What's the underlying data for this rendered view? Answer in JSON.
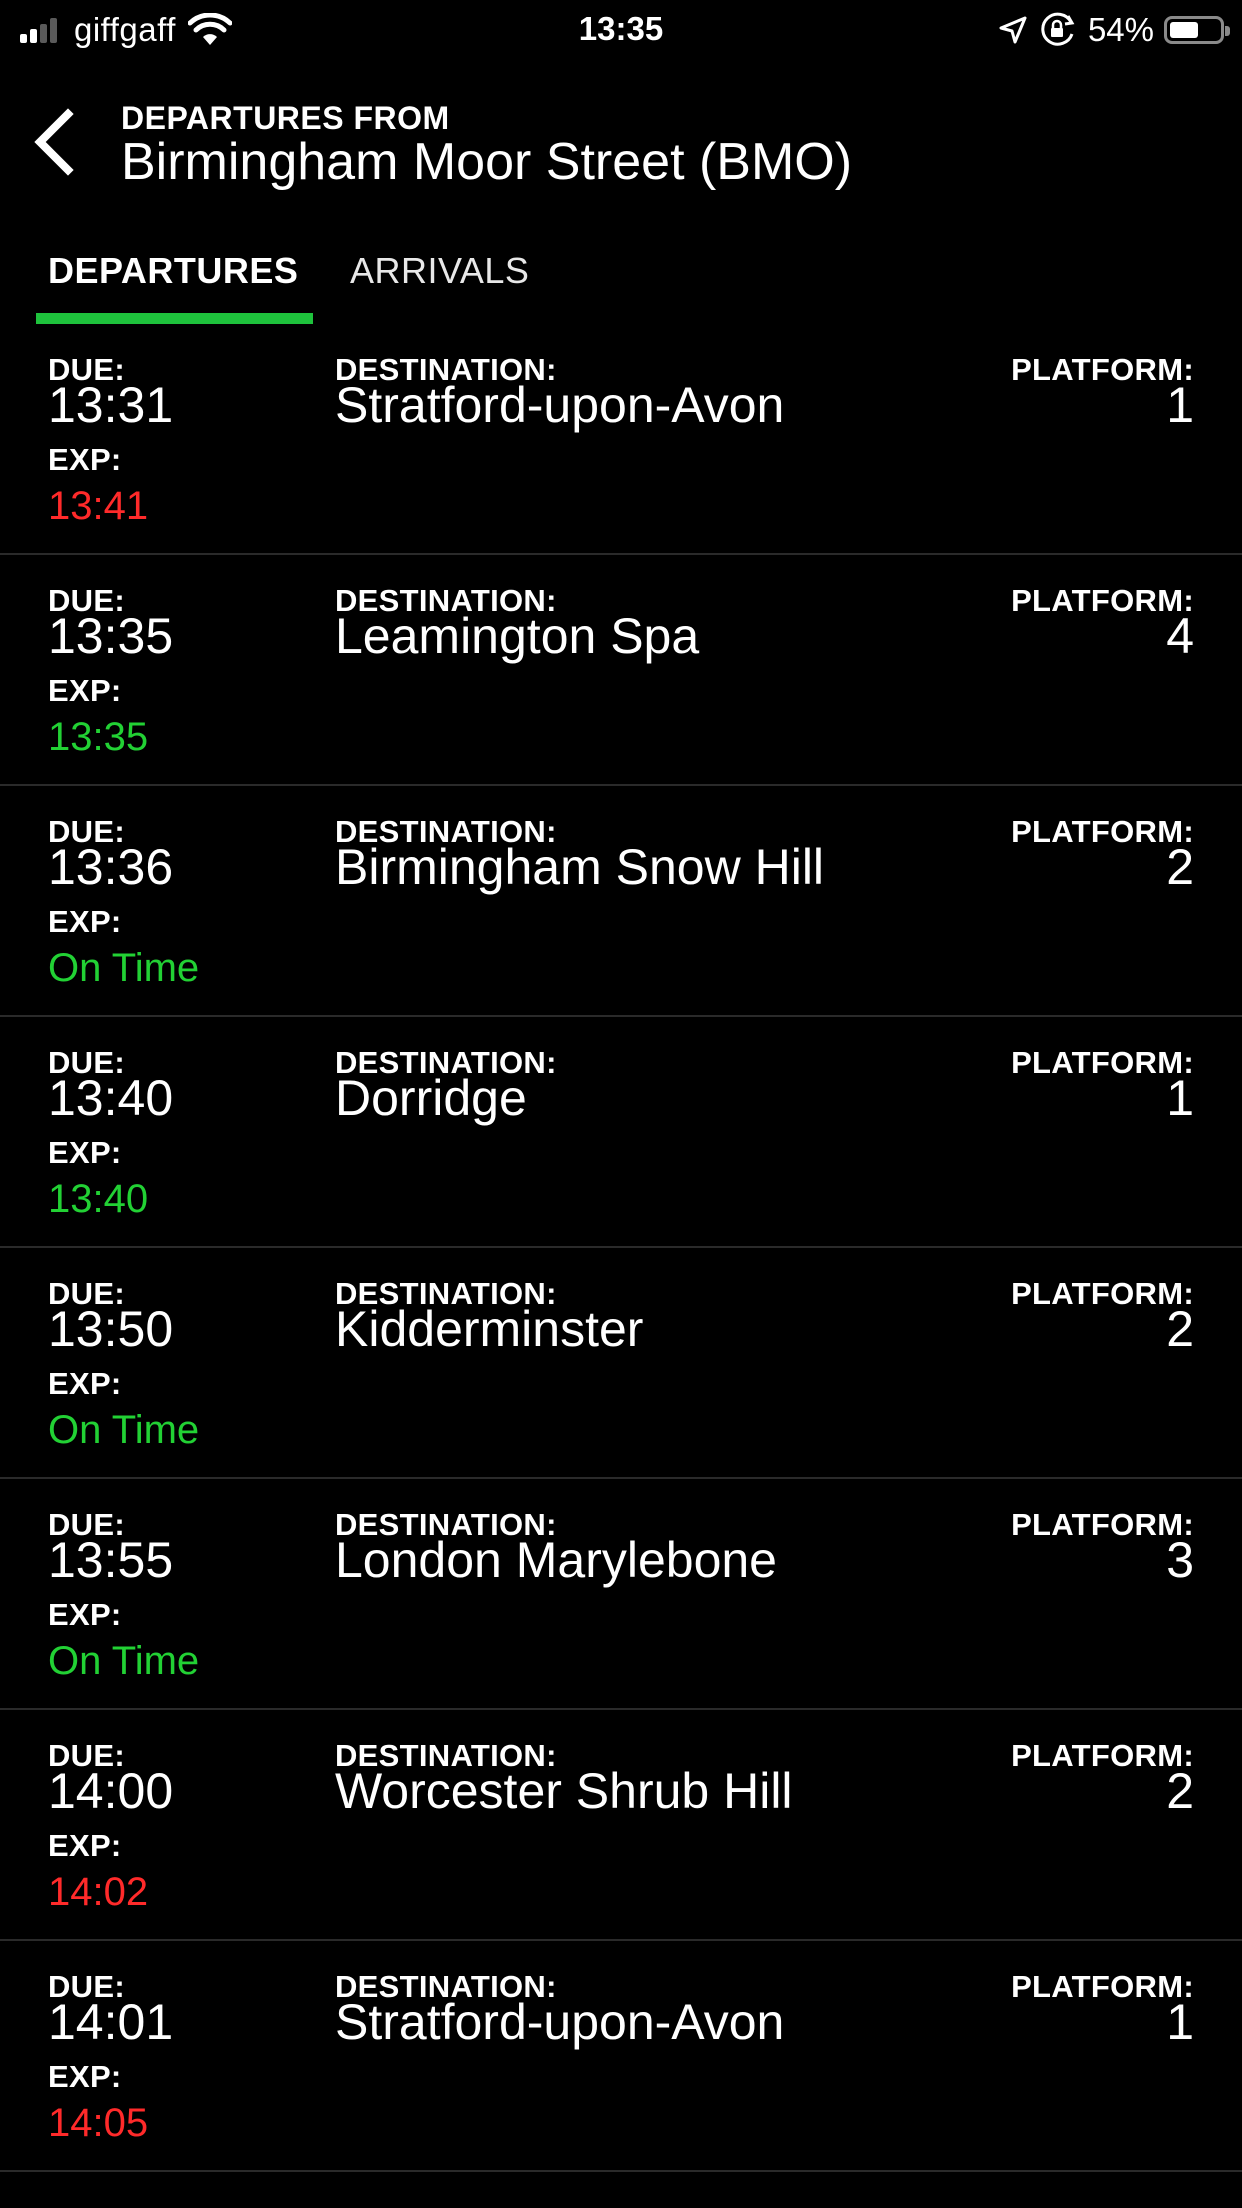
{
  "status_bar": {
    "carrier": "giffgaff",
    "time": "13:35",
    "battery": "54%"
  },
  "header": {
    "subtitle": "DEPARTURES FROM",
    "title": "Birmingham Moor Street (BMO)"
  },
  "tabs": [
    {
      "label": "DEPARTURES",
      "active": true
    },
    {
      "label": "ARRIVALS",
      "active": false
    }
  ],
  "labels": {
    "due": "DUE:",
    "exp": "EXP:",
    "destination": "DESTINATION:",
    "platform": "PLATFORM:"
  },
  "colors": {
    "accent": "#1ec23c",
    "late": "#ff2a2a",
    "on_time": "#22d134",
    "background": "#000000"
  },
  "departures": [
    {
      "due": "13:31",
      "exp": "13:41",
      "status": "late",
      "destination": "Stratford-upon-Avon",
      "platform": "1"
    },
    {
      "due": "13:35",
      "exp": "13:35",
      "status": "ontime",
      "destination": "Leamington Spa",
      "platform": "4"
    },
    {
      "due": "13:36",
      "exp": "On Time",
      "status": "ontime",
      "destination": "Birmingham Snow Hill",
      "platform": "2"
    },
    {
      "due": "13:40",
      "exp": "13:40",
      "status": "ontime",
      "destination": "Dorridge",
      "platform": "1"
    },
    {
      "due": "13:50",
      "exp": "On Time",
      "status": "ontime",
      "destination": "Kidderminster",
      "platform": "2"
    },
    {
      "due": "13:55",
      "exp": "On Time",
      "status": "ontime",
      "destination": "London Marylebone",
      "platform": "3"
    },
    {
      "due": "14:00",
      "exp": "14:02",
      "status": "late",
      "destination": "Worcester Shrub Hill",
      "platform": "2"
    },
    {
      "due": "14:01",
      "exp": "14:05",
      "status": "late",
      "destination": "Stratford-upon-Avon",
      "platform": "1"
    }
  ]
}
